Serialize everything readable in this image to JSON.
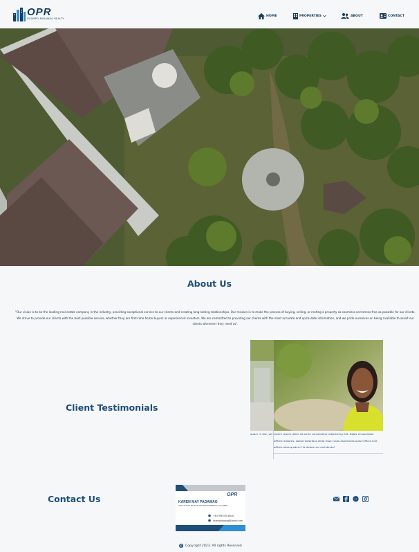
{
  "brand": {
    "logo_text": "OPR",
    "logo_subtext": "OCAMPO-PADAWAG REALTY"
  },
  "nav": {
    "home": "HOME",
    "properties": "PROPERTIES",
    "about": "ABOUT",
    "contact": "CONTACT"
  },
  "about": {
    "title": "About Us",
    "text": "\"Our vision is to be the leading real estate company in the industry, providing exceptional service to our clients and creating long-lasting relationships. Our mission is to make the process of buying, selling, or renting a property as seamless and stress-free as possible for our clients. We strive to provide our clients with the best possible service, whether they are first-time home buyers or experienced investors. We are committed to providing our clients with the most accurate and up-to-date information, and we pride ourselves on being available to assist our clients whenever they need us\"."
  },
  "testimonials": {
    "title": "Client Testimonials",
    "slide_text": "Lorem ipsum dolor sit amet consectetur adipisicing elit. Nobis recusandae officiis maiores, saepe doloribus dicta esse culpa asperiores quisi Officia iure officiis alias quidem? Id dolore vel architecto!",
    "prev_slide_text": "quam m dut, vel"
  },
  "contact": {
    "title": "Contact Us",
    "card": {
      "name": "KAREN MAY PADAWAG",
      "role": "REAL ESTATE BROKER AND ENVIRONMENTAL PLANNER",
      "phone": "+63 956 550 8040",
      "email": "karenpadawag@gmail.com",
      "logo": "OPR"
    },
    "socials": [
      "email-icon",
      "facebook-icon",
      "messenger-icon",
      "instagram-icon"
    ]
  },
  "footer": {
    "copyright": "Copyright 2023. All rights Reserved"
  },
  "colors": {
    "primary": "#1f4e79",
    "background": "#f5f7f9",
    "accent_blue": "#2e8fd6"
  }
}
